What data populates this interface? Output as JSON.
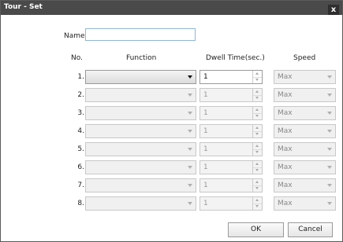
{
  "window": {
    "title": "Tour - Set",
    "close_glyph": "x"
  },
  "name": {
    "label": "Name",
    "value": ""
  },
  "headers": {
    "no": "No.",
    "function": "Function",
    "dwell": "Dwell Time(sec.)",
    "speed": "Speed"
  },
  "rows": [
    {
      "no": "1.",
      "dwell": "1",
      "speed": "Max"
    },
    {
      "no": "2.",
      "dwell": "1",
      "speed": "Max"
    },
    {
      "no": "3.",
      "dwell": "1",
      "speed": "Max"
    },
    {
      "no": "4.",
      "dwell": "1",
      "speed": "Max"
    },
    {
      "no": "5.",
      "dwell": "1",
      "speed": "Max"
    },
    {
      "no": "6.",
      "dwell": "1",
      "speed": "Max"
    },
    {
      "no": "7.",
      "dwell": "1",
      "speed": "Max"
    },
    {
      "no": "8.",
      "dwell": "1",
      "speed": "Max"
    }
  ],
  "buttons": {
    "ok": "OK",
    "cancel": "Cancel"
  }
}
